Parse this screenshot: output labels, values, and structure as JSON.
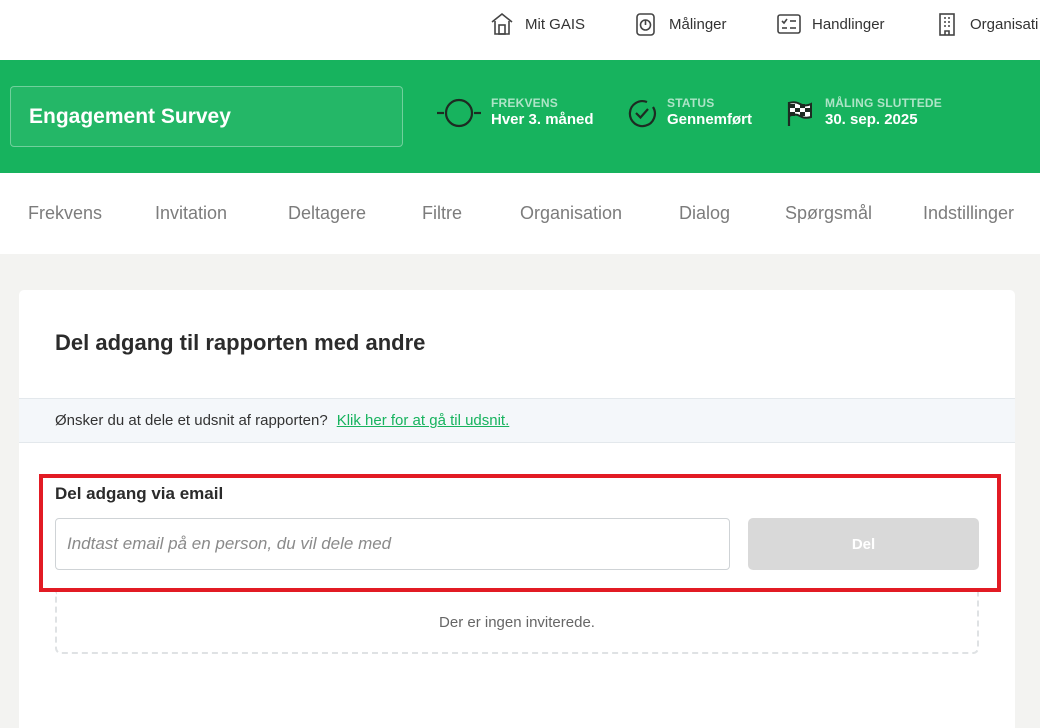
{
  "topnav": {
    "items": [
      {
        "label": "Mit GAIS",
        "icon": "home-icon"
      },
      {
        "label": "Målinger",
        "icon": "survey-icon"
      },
      {
        "label": "Handlinger",
        "icon": "checklist-icon"
      },
      {
        "label": "Organisati",
        "icon": "building-icon"
      }
    ]
  },
  "survey": {
    "title": "Engagement Survey",
    "meta": [
      {
        "label": "FREKVENS",
        "value": "Hver 3. måned",
        "icon": "frequency-icon"
      },
      {
        "label": "STATUS",
        "value": "Gennemført",
        "icon": "check-circle-icon"
      },
      {
        "label": "MÅLING SLUTTEDE",
        "value": "30. sep. 2025",
        "icon": "finish-flag-icon"
      }
    ]
  },
  "tabs": [
    "Frekvens",
    "Invitation",
    "Deltagere",
    "Filtre",
    "Organisation",
    "Dialog",
    "Spørgsmål",
    "Indstillinger"
  ],
  "card": {
    "title": "Del adgang til rapporten med andre",
    "info_text": "Ønsker du at dele et udsnit af rapporten?",
    "info_link": "Klik her for at gå til udsnit.",
    "share_label": "Del adgang via email",
    "email_placeholder": "Indtast email på en person, du vil dele med",
    "email_value": "",
    "share_button": "Del",
    "empty_text": "Der er ingen inviterede."
  },
  "colors": {
    "brand_green": "#17b35e",
    "highlight_red": "#e21b24",
    "disabled_button": "#d9d9d9"
  }
}
